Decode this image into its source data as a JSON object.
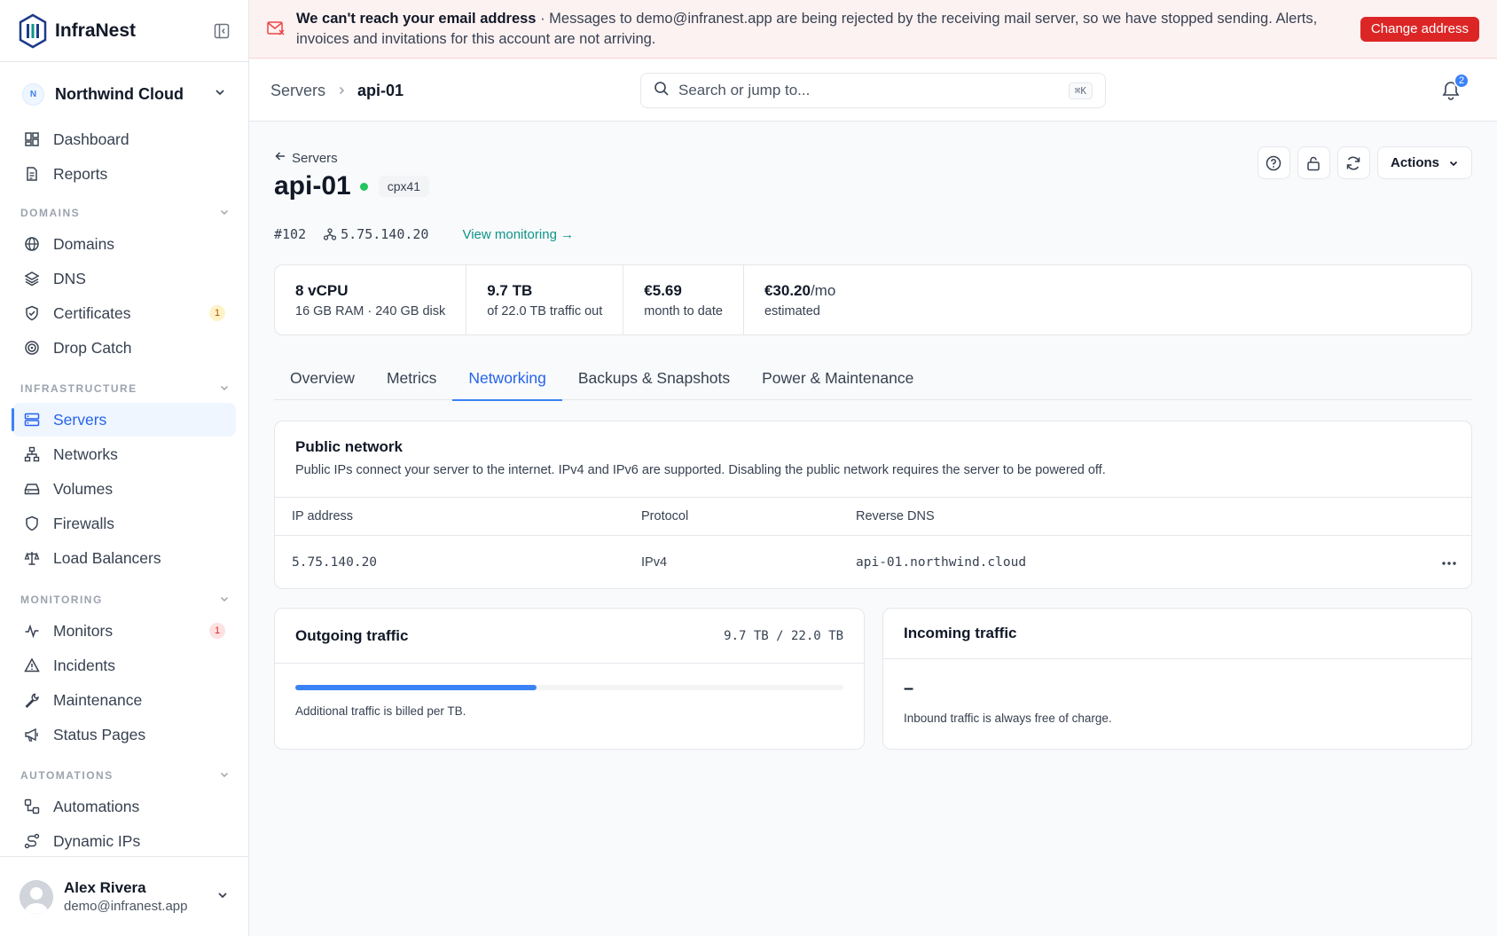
{
  "app": {
    "name": "InfraNest"
  },
  "org": {
    "initial": "N",
    "name": "Northwind Cloud"
  },
  "nav": {
    "top": [
      {
        "label": "Dashboard",
        "icon": "dashboard-icon"
      },
      {
        "label": "Reports",
        "icon": "report-icon"
      }
    ],
    "sections": [
      {
        "label": "DOMAINS",
        "items": [
          {
            "label": "Domains",
            "icon": "globe-icon"
          },
          {
            "label": "DNS",
            "icon": "layers-icon"
          },
          {
            "label": "Certificates",
            "icon": "shield-check-icon",
            "badge": "1"
          },
          {
            "label": "Drop Catch",
            "icon": "target-icon"
          }
        ]
      },
      {
        "label": "INFRASTRUCTURE",
        "items": [
          {
            "label": "Servers",
            "icon": "server-icon",
            "active": true
          },
          {
            "label": "Networks",
            "icon": "network-icon"
          },
          {
            "label": "Volumes",
            "icon": "drive-icon"
          },
          {
            "label": "Firewalls",
            "icon": "shield-icon"
          },
          {
            "label": "Load Balancers",
            "icon": "scale-icon"
          }
        ]
      },
      {
        "label": "MONITORING",
        "items": [
          {
            "label": "Monitors",
            "icon": "pulse-icon",
            "badge": "1"
          },
          {
            "label": "Incidents",
            "icon": "alert-icon"
          },
          {
            "label": "Maintenance",
            "icon": "wrench-icon"
          },
          {
            "label": "Status Pages",
            "icon": "megaphone-icon"
          }
        ]
      },
      {
        "label": "AUTOMATIONS",
        "items": [
          {
            "label": "Automations",
            "icon": "workflow-icon"
          },
          {
            "label": "Dynamic IPs",
            "icon": "route-icon"
          }
        ]
      }
    ]
  },
  "user": {
    "name": "Alex Rivera",
    "email": "demo@infranest.app"
  },
  "banner": {
    "title": "We can't reach your email address",
    "message": " · Messages to demo@infranest.app are being rejected by the receiving mail server, so we have stopped sending. Alerts, invoices and invitations for this account are not arriving.",
    "button": "Change address"
  },
  "topbar": {
    "breadcrumb": [
      "Servers",
      "api-01"
    ],
    "search_placeholder": "Search or jump to...",
    "shortcut": "⌘K",
    "notifications": "2"
  },
  "server": {
    "back_label": "Servers",
    "name": "api-01",
    "status_color": "#22c55e",
    "plan": "cpx41",
    "id": "#102",
    "ip": "5.75.140.20",
    "view_monitoring": "View monitoring",
    "actions_label": "Actions"
  },
  "stats": [
    {
      "value": "8 vCPU",
      "unit": "",
      "label": "16 GB RAM · 240 GB disk"
    },
    {
      "value": "9.7 TB",
      "unit": "",
      "label": "of 22.0 TB traffic out"
    },
    {
      "value": "€5.69",
      "unit": "",
      "label": "month to date"
    },
    {
      "value": "€30.20",
      "unit": "/mo",
      "label": "estimated"
    }
  ],
  "tabs": [
    {
      "label": "Overview"
    },
    {
      "label": "Metrics"
    },
    {
      "label": "Networking",
      "active": true
    },
    {
      "label": "Backups & Snapshots"
    },
    {
      "label": "Power & Maintenance"
    }
  ],
  "public_network": {
    "title": "Public network",
    "description": "Public IPs connect your server to the internet. IPv4 and IPv6 are supported. Disabling the public network requires the server to be powered off.",
    "columns": [
      "IP address",
      "Protocol",
      "Reverse DNS"
    ],
    "rows": [
      {
        "ip": "5.75.140.20",
        "protocol": "IPv4",
        "rdns": "api-01.northwind.cloud"
      }
    ]
  },
  "outgoing": {
    "title": "Outgoing traffic",
    "value": "9.7 TB / 22.0 TB",
    "fill_fraction": 0.44,
    "note": "Additional traffic is billed per TB."
  },
  "incoming": {
    "title": "Incoming traffic",
    "value": "–",
    "note": "Inbound traffic is always free of charge."
  },
  "colors": {
    "accent": "#3b82f6",
    "danger": "#dc2626",
    "success": "#22c55e",
    "link": "#0d9488"
  }
}
